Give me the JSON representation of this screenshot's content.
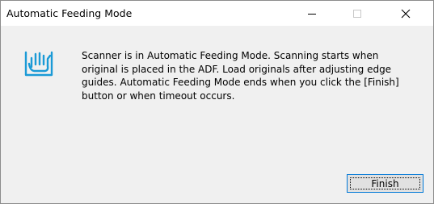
{
  "window": {
    "title": "Automatic Feeding Mode"
  },
  "titlebar": {
    "minimize_icon": "minimize-icon",
    "maximize_icon": "maximize-icon",
    "close_icon": "close-icon"
  },
  "content": {
    "icon": "adf-feeding-hand-icon",
    "icon_color": "#1a9ad6",
    "message": "Scanner is in Automatic Feeding Mode. Scanning starts when\noriginal is placed in the ADF. Load originals after adjusting edge\nguides. Automatic Feeding Mode ends when you click the [Finish]\nbutton or when timeout occurs."
  },
  "buttons": {
    "finish_label": "Finish"
  },
  "colors": {
    "dialog_background": "#f0f0f0",
    "titlebar_background": "#ffffff",
    "focus_border": "#0078d7"
  }
}
